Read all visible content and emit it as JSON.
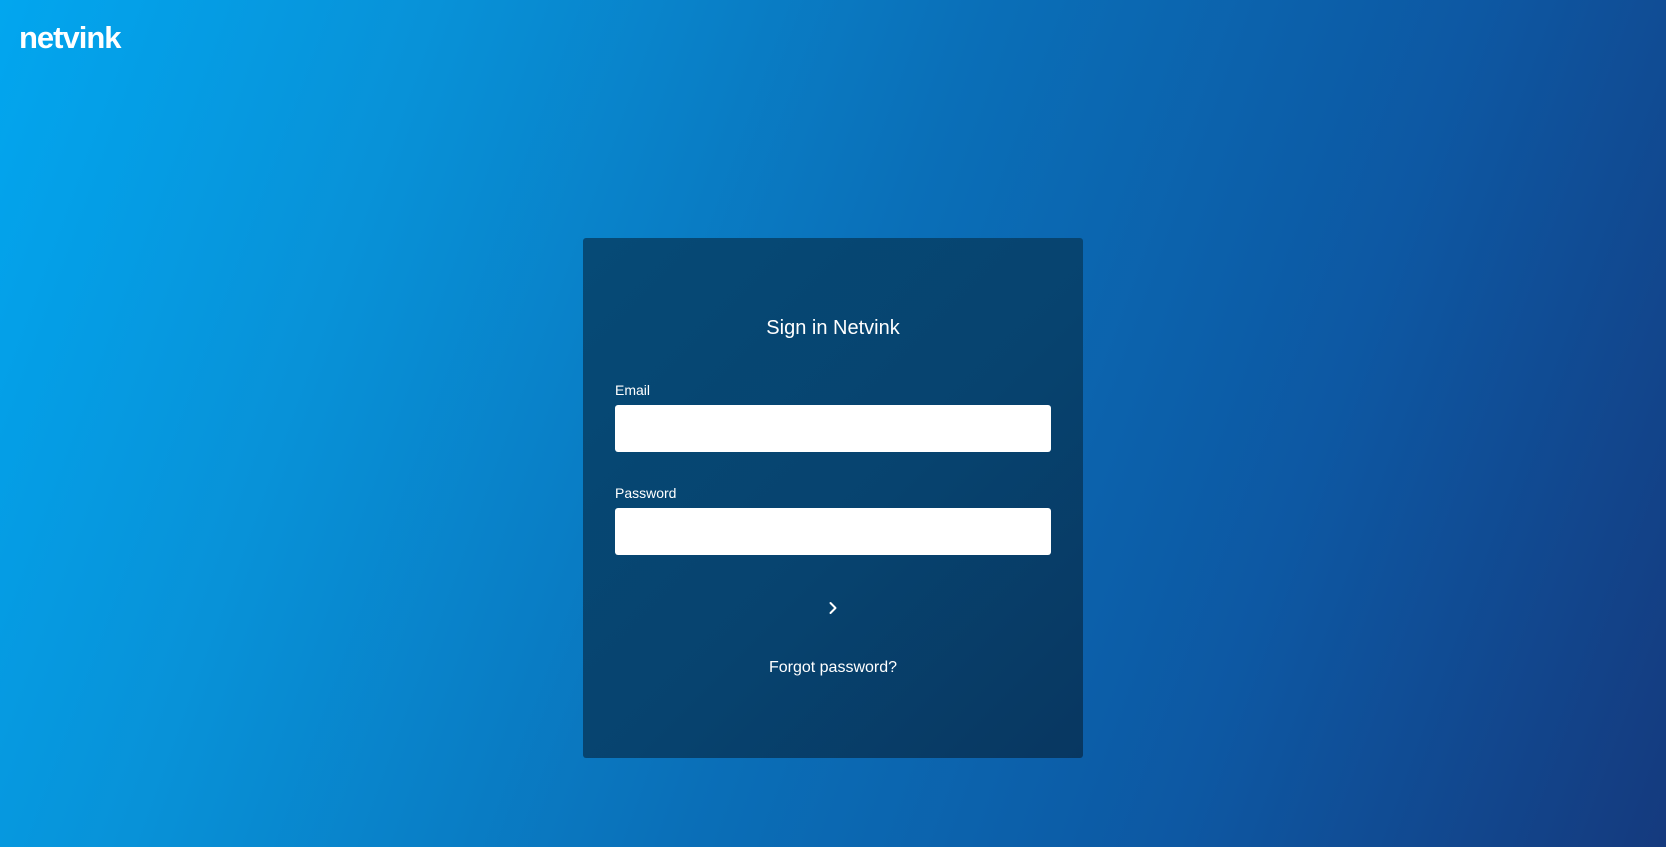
{
  "brand": {
    "logo_text": "netvink"
  },
  "login_card": {
    "title": "Sign in Netvink",
    "email_label": "Email",
    "email_value": "",
    "password_label": "Password",
    "password_value": "",
    "submit_icon": "chevron-right-icon",
    "forgot_password_text": "Forgot password?"
  },
  "colors": {
    "background_gradient_start": "#02a6ef",
    "background_gradient_end": "#153a7e",
    "card_background": "#064a76",
    "input_background": "#ffffff",
    "text": "#ffffff"
  }
}
